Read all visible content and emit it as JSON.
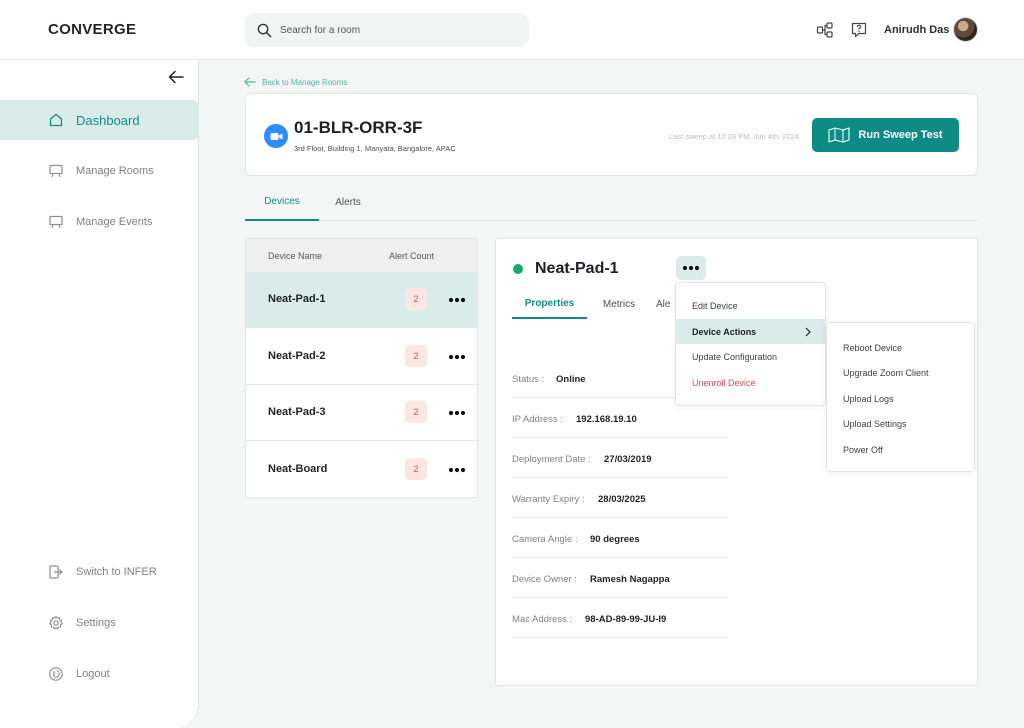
{
  "app": {
    "logo": "CONVERGE"
  },
  "search": {
    "placeholder": "Search for a room"
  },
  "user": {
    "name": "Anirudh Das"
  },
  "sidebar": {
    "items": [
      {
        "label": "Dashboard",
        "icon": "home-icon",
        "active": true
      },
      {
        "label": "Manage Rooms",
        "icon": "board-icon"
      },
      {
        "label": "Manage Events",
        "icon": "board-icon"
      }
    ],
    "footer": [
      {
        "label": "Switch to INFER",
        "icon": "switch-icon"
      },
      {
        "label": "Settings",
        "icon": "gear-icon"
      },
      {
        "label": "Logout",
        "icon": "power-icon"
      }
    ]
  },
  "breadcrumb": {
    "back_label": "Back to Manage Rooms"
  },
  "room": {
    "title": "01-BLR-ORR-3F",
    "location": "3rd Floor, Building 1, Manyata,  Bangalore, APAC",
    "last_sweep": "Last sweep at 10:28 PM, Jun 4th, 2024",
    "sweep_button": "Run Sweep Test"
  },
  "tabs": [
    "Devices",
    "Alerts"
  ],
  "devices": {
    "columns": [
      "Device Name",
      "Alert Count"
    ],
    "rows": [
      {
        "name": "Neat-Pad-1",
        "alerts": "2"
      },
      {
        "name": "Neat-Pad-2",
        "alerts": "2"
      },
      {
        "name": "Neat-Pad-3",
        "alerts": "2"
      },
      {
        "name": "Neat-Board",
        "alerts": "2"
      }
    ]
  },
  "detail": {
    "title": "Neat-Pad-1",
    "status_color": "#1aa86a",
    "tabs": [
      "Properties",
      "Metrics",
      "Ale"
    ],
    "properties": [
      {
        "key": "Status :",
        "value": "Online"
      },
      {
        "key": "IP Address :",
        "value": "192.168.19.10"
      },
      {
        "key": "Deployment Date :",
        "value": "27/03/2019"
      },
      {
        "key": "Warranty Expiry :",
        "value": "28/03/2025"
      },
      {
        "key": "Camera Angle :",
        "value": "90 degrees"
      },
      {
        "key": "Device Owner :",
        "value": "Ramesh Nagappa"
      },
      {
        "key": "Mac Address :",
        "value": "98-AD-89-99-JU-I9"
      }
    ]
  },
  "actions_menu": {
    "items": [
      "Edit Device",
      "Device Actions",
      "Update Configuration",
      "Unenroll Device"
    ]
  },
  "device_actions_submenu": {
    "items": [
      "Reboot Device",
      "Upgrade Zoom Client",
      "Upload Logs",
      "Upload Settings",
      "Power Off"
    ]
  },
  "colors": {
    "accent": "#0e8b84",
    "accent_light": "#d9ecea",
    "danger": "#e5474a"
  }
}
